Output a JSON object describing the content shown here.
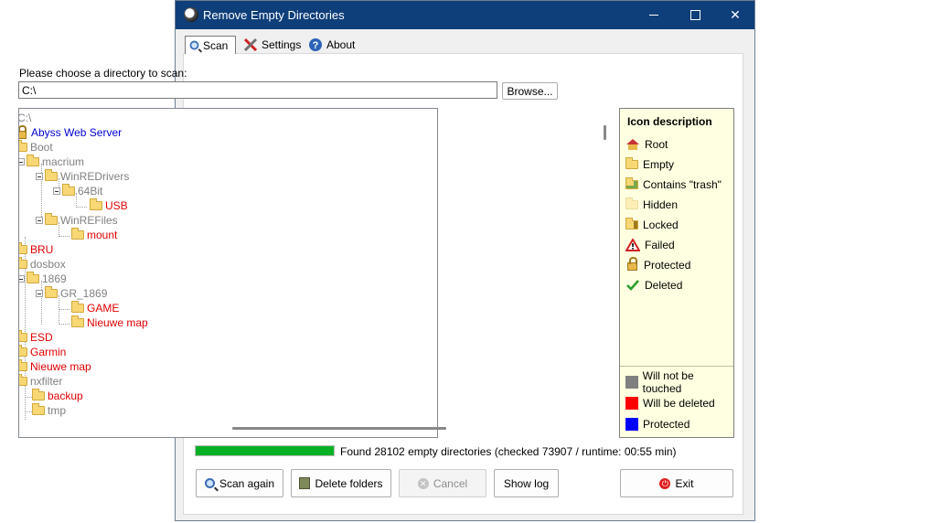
{
  "window": {
    "title": "Remove Empty Directories"
  },
  "tabs": [
    {
      "label": "Scan",
      "icon": "magnifier-icon",
      "selected": true
    },
    {
      "label": "Settings",
      "icon": "tools-icon"
    },
    {
      "label": "About",
      "icon": "help-icon"
    }
  ],
  "scan": {
    "prompt": "Please choose a directory to scan:",
    "path": "C:\\",
    "browse_label": "Browse..."
  },
  "tree": {
    "root": "C:\\",
    "nodes": [
      {
        "label": "Abyss Web Server",
        "color": "blue"
      },
      {
        "label": "Boot",
        "color": "grey"
      },
      {
        "label": "macrium",
        "color": "grey"
      },
      {
        "label": "WinREDrivers",
        "color": "grey"
      },
      {
        "label": "64Bit",
        "color": "grey"
      },
      {
        "label": "USB",
        "color": "red"
      },
      {
        "label": "WinREFiles",
        "color": "grey"
      },
      {
        "label": "mount",
        "color": "red"
      },
      {
        "label": "BRU",
        "color": "red"
      },
      {
        "label": "dosbox",
        "color": "grey"
      },
      {
        "label": "1869",
        "color": "grey"
      },
      {
        "label": "GR_1869",
        "color": "grey"
      },
      {
        "label": "GAME",
        "color": "red"
      },
      {
        "label": "Nieuwe map",
        "color": "red"
      },
      {
        "label": "ESD",
        "color": "red"
      },
      {
        "label": "Garmin",
        "color": "red"
      },
      {
        "label": "Nieuwe map",
        "color": "red"
      },
      {
        "label": "nxfilter",
        "color": "grey"
      },
      {
        "label": "backup",
        "color": "red"
      },
      {
        "label": "tmp",
        "color": "grey"
      }
    ]
  },
  "legend": {
    "title": "Icon description",
    "icons": [
      {
        "label": "Root",
        "icon": "root-icon"
      },
      {
        "label": "Empty",
        "icon": "folder-icon"
      },
      {
        "label": "Contains \"trash\"",
        "icon": "trash-folder-icon"
      },
      {
        "label": "Hidden",
        "icon": "hidden-folder-icon"
      },
      {
        "label": "Locked",
        "icon": "locked-folder-icon"
      },
      {
        "label": "Failed",
        "icon": "warning-icon"
      },
      {
        "label": "Protected",
        "icon": "lock-icon"
      },
      {
        "label": "Deleted",
        "icon": "check-icon"
      }
    ],
    "colors": [
      {
        "label": "Will not be touched",
        "color": "#808080"
      },
      {
        "label": "Will be deleted",
        "color": "#ff0000"
      },
      {
        "label": "Protected",
        "color": "#0000ff"
      }
    ]
  },
  "progress": {
    "fraction": 1.0,
    "color": "#06b025"
  },
  "status": "Found 28102 empty directories (checked 73907 / runtime: 00:55 min)",
  "buttons": {
    "scan_again": "Scan again",
    "delete_folders": "Delete folders",
    "cancel": "Cancel",
    "show_log": "Show log",
    "exit": "Exit"
  }
}
